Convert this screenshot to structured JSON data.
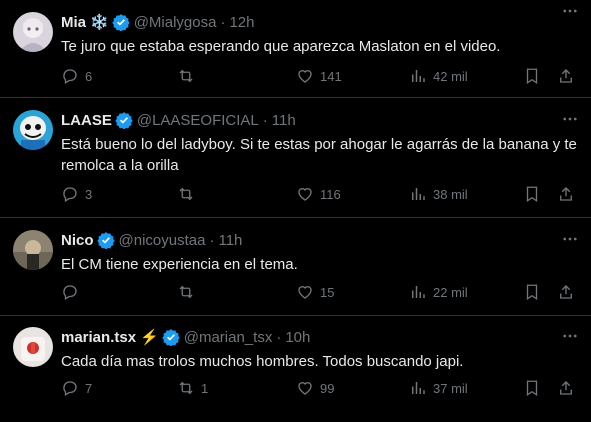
{
  "tweets": [
    {
      "name": "Mia",
      "name_emoji": "❄️",
      "handle": "@Mialygosa",
      "time": "12h",
      "text": "Te juro que estaba esperando que aparezca Maslaton en el video.",
      "replies": "6",
      "retweets": "",
      "likes": "141",
      "views": "42 mil"
    },
    {
      "name": "LAASE",
      "name_emoji": "",
      "handle": "@LAASEOFICIAL",
      "time": "11h",
      "text": "Está bueno lo del ladyboy. Si te estas por ahogar le agarrás de la banana y te remolca a la orilla",
      "replies": "3",
      "retweets": "",
      "likes": "116",
      "views": "38 mil"
    },
    {
      "name": "Nico",
      "name_emoji": "",
      "handle": "@nicoyustaa",
      "time": "11h",
      "text": "El CM tiene experiencia en el tema.",
      "replies": "",
      "retweets": "",
      "likes": "15",
      "views": "22 mil"
    },
    {
      "name": "marian.tsx",
      "name_emoji": "⚡",
      "handle": "@marian_tsx",
      "time": "10h",
      "text": "Cada día mas trolos muchos hombres. Todos buscando japi.",
      "replies": "7",
      "retweets": "1",
      "likes": "99",
      "views": "37 mil"
    }
  ],
  "colors": {
    "verified": "#1d9bf0",
    "muted": "#71767b",
    "text": "#e7e9ea",
    "divider": "#2f3336"
  }
}
